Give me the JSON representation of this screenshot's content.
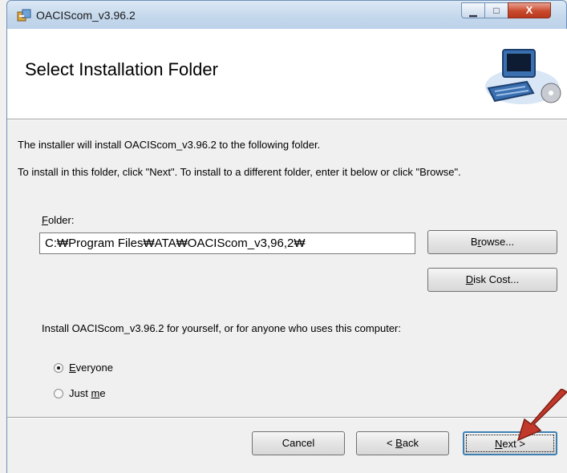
{
  "window": {
    "title": "OACIScom_v3.96.2",
    "close_glyph": "X"
  },
  "header": {
    "title": "Select Installation Folder"
  },
  "intro_line1": "The installer will install OACIScom_v3.96.2 to the following folder.",
  "intro_line2": "To install in this folder, click \"Next\". To install to a different folder, enter it below or click \"Browse\".",
  "folder": {
    "label_mnemonic": "F",
    "label_rest": "older:",
    "value": "C:₩Program Files₩ATA₩OACIScom_v3,96,2₩"
  },
  "browse_button": {
    "pre": "B",
    "mnemonic": "r",
    "post": "owse..."
  },
  "disk_cost_button": {
    "mnemonic": "D",
    "post": "isk Cost..."
  },
  "install_for_text": "Install OACIScom_v3.96.2 for yourself, or for anyone who uses this computer:",
  "radio_everyone": {
    "mnemonic": "E",
    "post": "veryone",
    "selected": true
  },
  "radio_justme": {
    "pre": "Just ",
    "mnemonic": "m",
    "post": "e",
    "selected": false
  },
  "footer": {
    "cancel_label": "Cancel",
    "back": {
      "pre": "< ",
      "mnemonic": "B",
      "post": "ack"
    },
    "next": {
      "mnemonic": "N",
      "post": "ext >"
    }
  },
  "colors": {
    "arrow": "#c0392b",
    "title_bar": "#c5d8ec",
    "close_button": "#c94a2c"
  }
}
